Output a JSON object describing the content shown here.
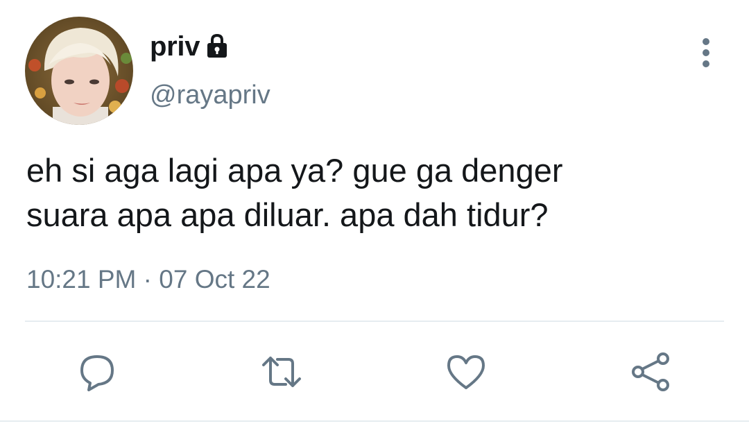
{
  "author": {
    "display_name": "priv",
    "handle": "@rayapriv",
    "protected_icon": "lock-icon",
    "avatar_icon": "profile-photo"
  },
  "tweet": {
    "text_lines": [
      "eh si aga lagi apa ya? gue ga denger",
      "suara apa apa diluar. apa dah tidur?"
    ],
    "time": "10:21 PM",
    "separator": "·",
    "date": "07 Oct 22"
  },
  "actions": [
    {
      "name": "reply",
      "icon": "speech-bubble-icon"
    },
    {
      "name": "retweet",
      "icon": "retweet-icon"
    },
    {
      "name": "like",
      "icon": "heart-icon"
    },
    {
      "name": "share",
      "icon": "share-icon"
    }
  ],
  "more_icon": "more-vertical-icon",
  "colors": {
    "text": "#14171a",
    "secondary": "#657786",
    "divider": "#e6ecf0"
  }
}
